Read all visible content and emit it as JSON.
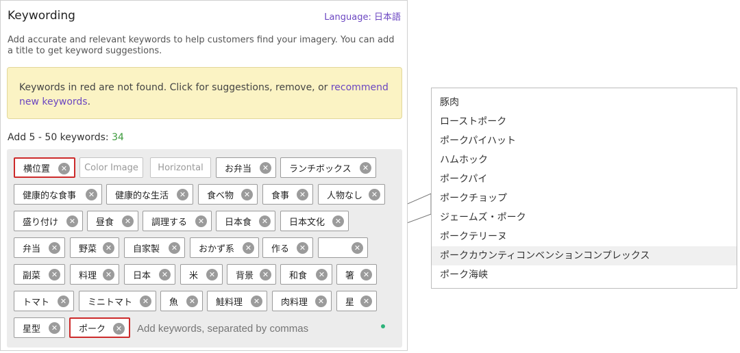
{
  "header": {
    "title": "Keywording",
    "language_label": "Language:",
    "language_value": "日本語"
  },
  "description": "Add accurate and relevant keywords to help customers find your imagery. You can add a title to get keyword suggestions.",
  "warning": {
    "text": "Keywords in red are not found. Click for suggestions, remove, or",
    "link": "recommend new keywords",
    "suffix": "."
  },
  "keyword_count": {
    "label": "Add 5 - 50 keywords:",
    "count": "34"
  },
  "keywords": [
    {
      "text": "横位置",
      "state": "not-found",
      "removable": true
    },
    {
      "text": "Color Image",
      "state": "disabled",
      "removable": false
    },
    {
      "text": "Horizontal",
      "state": "disabled",
      "removable": false
    },
    {
      "text": "お弁当",
      "state": "normal",
      "removable": true
    },
    {
      "text": "ランチボックス",
      "state": "normal",
      "removable": true
    },
    {
      "text": "健康的な食事",
      "state": "normal",
      "removable": true
    },
    {
      "text": "健康的な生活",
      "state": "normal",
      "removable": true
    },
    {
      "text": "食べ物",
      "state": "normal",
      "removable": true
    },
    {
      "text": "食事",
      "state": "normal",
      "removable": true
    },
    {
      "text": "人物なし",
      "state": "normal",
      "removable": true
    },
    {
      "text": "盛り付け",
      "state": "normal",
      "removable": true
    },
    {
      "text": "昼食",
      "state": "normal",
      "removable": true
    },
    {
      "text": "調理する",
      "state": "normal",
      "removable": true
    },
    {
      "text": "日本食",
      "state": "normal",
      "removable": true
    },
    {
      "text": "日本文化",
      "state": "normal",
      "removable": true
    },
    {
      "text": "弁当",
      "state": "normal",
      "removable": true
    },
    {
      "text": "野菜",
      "state": "normal",
      "removable": true
    },
    {
      "text": "自家製",
      "state": "normal",
      "removable": true
    },
    {
      "text": "おかず系",
      "state": "normal",
      "removable": true
    },
    {
      "text": "作る",
      "state": "normal",
      "removable": true
    },
    {
      "text": "",
      "state": "normal",
      "removable": true
    },
    {
      "text": "副菜",
      "state": "normal",
      "removable": true
    },
    {
      "text": "料理",
      "state": "normal",
      "removable": true
    },
    {
      "text": "日本",
      "state": "normal",
      "removable": true
    },
    {
      "text": "米",
      "state": "normal",
      "removable": true
    },
    {
      "text": "背景",
      "state": "normal",
      "removable": true
    },
    {
      "text": "和食",
      "state": "normal",
      "removable": true
    },
    {
      "text": "箸",
      "state": "normal",
      "removable": true
    },
    {
      "text": "トマト",
      "state": "normal",
      "removable": true
    },
    {
      "text": "ミニトマト",
      "state": "normal",
      "removable": true
    },
    {
      "text": "魚",
      "state": "normal",
      "removable": true
    },
    {
      "text": "鮭料理",
      "state": "normal",
      "removable": true
    },
    {
      "text": "肉料理",
      "state": "normal",
      "removable": true
    },
    {
      "text": "星",
      "state": "normal",
      "removable": true
    },
    {
      "text": "星型",
      "state": "normal",
      "removable": true
    },
    {
      "text": "ポーク",
      "state": "not-found",
      "removable": true
    }
  ],
  "input": {
    "placeholder": "Add keywords, separated by commas"
  },
  "suggestions": [
    "豚肉",
    "ローストポーク",
    "ポークパイハット",
    "ハムホック",
    "ポークパイ",
    "ポークチョップ",
    "ジェームズ・ポーク",
    "ポークテリーヌ",
    "ポークカウンティコンベンションコンプレックス",
    "ポーク海峡"
  ],
  "highlighted_suggestion": 8,
  "colors": {
    "accent": "#6b46c1",
    "not_found_border": "#cc2a2a",
    "count_green": "#3c9a3c",
    "warning_bg": "#fbf3c4"
  }
}
